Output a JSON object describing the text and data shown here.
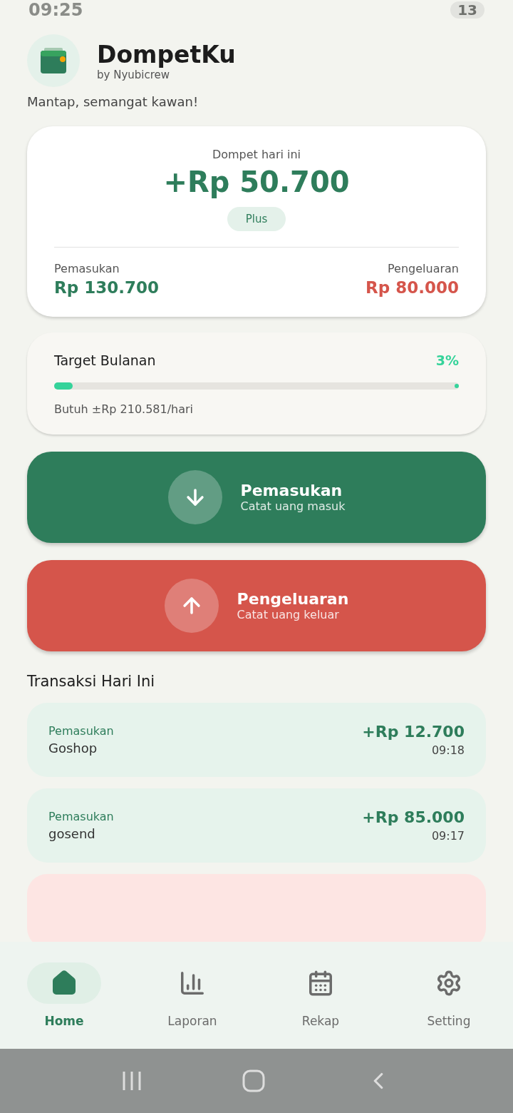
{
  "status_bar": {
    "time": "09:25",
    "battery": "13"
  },
  "app": {
    "title": "DompetKu",
    "subtitle": "by Nyubicrew",
    "greeting": "Mantap, semangat kawan!"
  },
  "summary": {
    "label": "Dompet hari ini",
    "balance": "+Rp 50.700",
    "badge": "Plus",
    "income_label": "Pemasukan",
    "income": "Rp 130.700",
    "expense_label": "Pengeluaran",
    "expense": "Rp 80.000"
  },
  "target": {
    "title": "Target Bulanan",
    "percent": "3%",
    "level": 0.03,
    "note": "Butuh ±Rp 210.581/hari"
  },
  "actions": [
    {
      "kind": "income",
      "title": "Pemasukan",
      "subtitle": "Catat uang masuk"
    },
    {
      "kind": "expense",
      "title": "Pengeluaran",
      "subtitle": "Catat uang keluar"
    }
  ],
  "transactions_title": "Transaksi Hari Ini",
  "transactions": [
    {
      "kind": "income",
      "category": "Pemasukan",
      "note": "Goshop",
      "amount": "+Rp 12.700",
      "time": "09:18"
    },
    {
      "kind": "income",
      "category": "Pemasukan",
      "note": "gosend",
      "amount": "+Rp 85.000",
      "time": "09:17"
    },
    {
      "kind": "expense"
    }
  ],
  "nav": [
    {
      "label": "Home",
      "selected": true
    },
    {
      "label": "Laporan",
      "selected": false
    },
    {
      "label": "Rekap",
      "selected": false
    },
    {
      "label": "Setting",
      "selected": false
    }
  ]
}
